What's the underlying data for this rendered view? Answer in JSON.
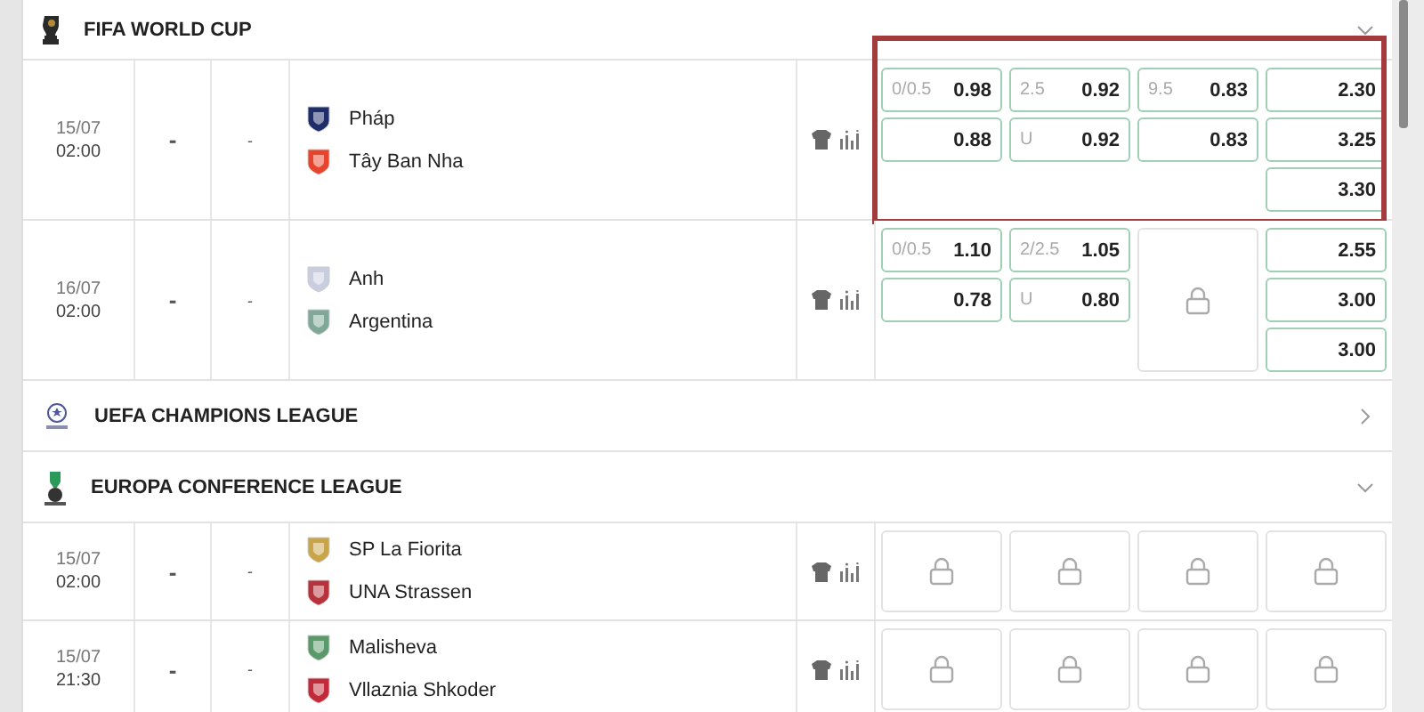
{
  "leagues": [
    {
      "name": "FIFA WORLD CUP",
      "kind": "trophy",
      "expanded": true,
      "matches": [
        {
          "date": "15/07",
          "time": "02:00",
          "score_1": "-",
          "score_2": "-",
          "highlighted": true,
          "teams": [
            {
              "name": "Pháp",
              "color": "#1f2d6b"
            },
            {
              "name": "Tây Ban Nha",
              "color": "#e8442c"
            }
          ],
          "odds": [
            [
              {
                "kind": "odds",
                "line": "0/0.5",
                "price": "0.98"
              },
              {
                "kind": "odds",
                "price": "0.88"
              }
            ],
            [
              {
                "kind": "odds",
                "line": "2.5",
                "price": "0.92"
              },
              {
                "kind": "odds",
                "line": "U",
                "price": "0.92"
              }
            ],
            [
              {
                "kind": "odds",
                "line": "9.5",
                "price": "0.83"
              },
              {
                "kind": "odds",
                "price": "0.83"
              }
            ],
            [
              {
                "kind": "odds",
                "price": "2.30"
              },
              {
                "kind": "odds",
                "price": "3.25"
              },
              {
                "kind": "odds",
                "price": "3.30"
              }
            ]
          ]
        },
        {
          "date": "16/07",
          "time": "02:00",
          "score_1": "-",
          "score_2": "-",
          "highlighted": false,
          "teams": [
            {
              "name": "Anh",
              "color": "#c8cde0"
            },
            {
              "name": "Argentina",
              "color": "#7fa898"
            }
          ],
          "odds": [
            [
              {
                "kind": "odds",
                "line": "0/0.5",
                "price": "1.10"
              },
              {
                "kind": "odds",
                "price": "0.78"
              }
            ],
            [
              {
                "kind": "odds",
                "line": "2/2.5",
                "price": "1.05"
              },
              {
                "kind": "odds",
                "line": "U",
                "price": "0.80"
              }
            ],
            [
              {
                "kind": "locked"
              }
            ],
            [
              {
                "kind": "odds",
                "price": "2.55"
              },
              {
                "kind": "odds",
                "price": "3.00"
              },
              {
                "kind": "odds",
                "price": "3.00"
              }
            ]
          ]
        }
      ]
    },
    {
      "name": "UEFA CHAMPIONS LEAGUE",
      "kind": "starball",
      "expanded": false
    },
    {
      "name": "EUROPA CONFERENCE LEAGUE",
      "kind": "cup",
      "expanded": true,
      "matches": [
        {
          "date": "15/07",
          "time": "02:00",
          "score_1": "-",
          "score_2": "-",
          "highlighted": false,
          "teams": [
            {
              "name": "SP La Fiorita",
              "color": "#c9a54a"
            },
            {
              "name": "UNA Strassen",
              "color": "#b8323c"
            }
          ],
          "odds": [
            [
              {
                "kind": "locked"
              }
            ],
            [
              {
                "kind": "locked"
              }
            ],
            [
              {
                "kind": "locked"
              }
            ],
            [
              {
                "kind": "locked"
              }
            ]
          ]
        },
        {
          "date": "15/07",
          "time": "21:30",
          "score_1": "-",
          "score_2": "-",
          "highlighted": false,
          "teams": [
            {
              "name": "Malisheva",
              "color": "#5a9a6a"
            },
            {
              "name": "Vllaznia Shkoder",
              "color": "#c22a3a"
            }
          ],
          "odds": [
            [
              {
                "kind": "locked"
              }
            ],
            [
              {
                "kind": "locked"
              }
            ],
            [
              {
                "kind": "locked"
              }
            ],
            [
              {
                "kind": "locked"
              }
            ]
          ]
        }
      ]
    }
  ]
}
